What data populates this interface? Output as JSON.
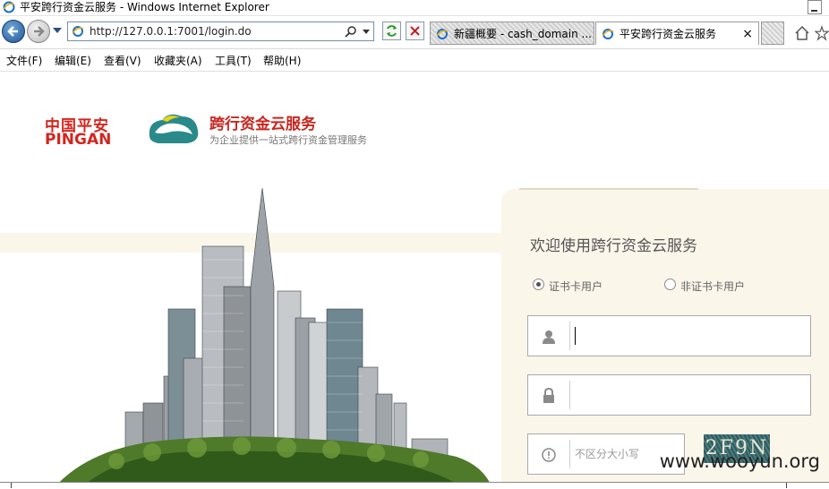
{
  "window": {
    "title": "平安跨行资金云服务 - Windows Internet Explorer"
  },
  "navbar": {
    "url": "http://127.0.0.1:7001/login.do"
  },
  "tabs": [
    {
      "label": "新疆概要 - cash_domain ..."
    },
    {
      "label": "平安跨行资金云服务",
      "close": "×"
    }
  ],
  "menu": [
    "文件(F)",
    "编辑(E)",
    "查看(V)",
    "收藏夹(A)",
    "工具(T)",
    "帮助(H)"
  ],
  "page": {
    "brand_cn": "中国平安",
    "brand_en": "PINGAN",
    "service_title": "跨行资金云服务",
    "service_slogan": "为企业提供一站式跨行资金管理服务",
    "welcome": "欢迎使用跨行资金云服务",
    "radio_cert": "证书卡用户",
    "radio_noncert": "非证书卡用户",
    "captcha_placeholder": "不区分大小写",
    "captcha_text": "2F9N",
    "watermark": "www.wooyun.org"
  },
  "colors": {
    "brand_red": "#d4251f",
    "panel_bg": "#fbf6ea",
    "cloud_teal": "#2a8a8a",
    "cloud_yellow": "#e8d21e"
  }
}
